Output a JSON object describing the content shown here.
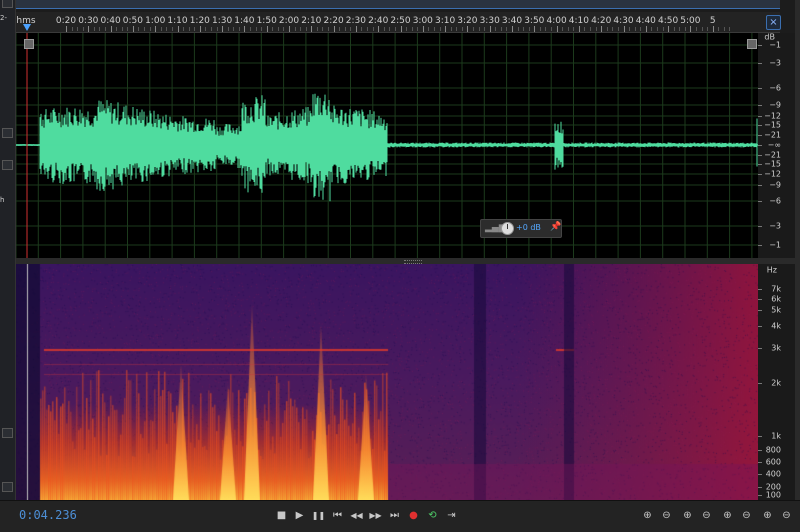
{
  "left_panel": {
    "text_a": "2-",
    "text_b": "h"
  },
  "ruler": {
    "unit_label": "hms",
    "labels": [
      "0:20",
      "0:30",
      "0:40",
      "0:50",
      "1:00",
      "1:10",
      "1:20",
      "1:30",
      "1:40",
      "1:50",
      "2:00",
      "2:10",
      "2:20",
      "2:30",
      "2:40",
      "2:50",
      "3:00",
      "3:10",
      "3:20",
      "3:30",
      "3:40",
      "3:50",
      "4:00",
      "4:10",
      "4:20",
      "4:30",
      "4:40",
      "4:50",
      "5:00",
      "5"
    ]
  },
  "close_label": "×",
  "db_scale": {
    "unit": "dB",
    "labels": [
      "−1",
      "−3",
      "−6",
      "−9",
      "−12",
      "−15",
      "−21",
      "−∞",
      "−21",
      "−15",
      "−12",
      "−9",
      "−6",
      "−3",
      "−1"
    ]
  },
  "hz_scale": {
    "unit": "Hz",
    "labels": [
      "7k",
      "6k",
      "5k",
      "4k",
      "3k",
      "2k",
      "1k",
      "800",
      "600",
      "400",
      "200",
      "100"
    ]
  },
  "hud": {
    "value": "+0 dB",
    "meter_icon": "level-meter-icon",
    "knob_icon": "volume-knob-icon",
    "pin_icon": "pin-icon"
  },
  "transport": {
    "time": "0:04.236",
    "buttons": {
      "stop": "■",
      "play": "▶",
      "pause": "❚❚",
      "to_start": "⏮",
      "rewind": "◀◀",
      "forward": "▶▶",
      "to_end": "⏭",
      "record": "●",
      "loop": "⟲",
      "skip": "⇥"
    },
    "zoom_buttons": [
      "⊕",
      "⊖",
      "⊕",
      "⊖",
      "⊕",
      "⊖",
      "⊕",
      "⊖"
    ]
  },
  "colors": {
    "waveform": "#4fdc9f",
    "playhead": "#d03030",
    "accent": "#4d8fd6"
  }
}
